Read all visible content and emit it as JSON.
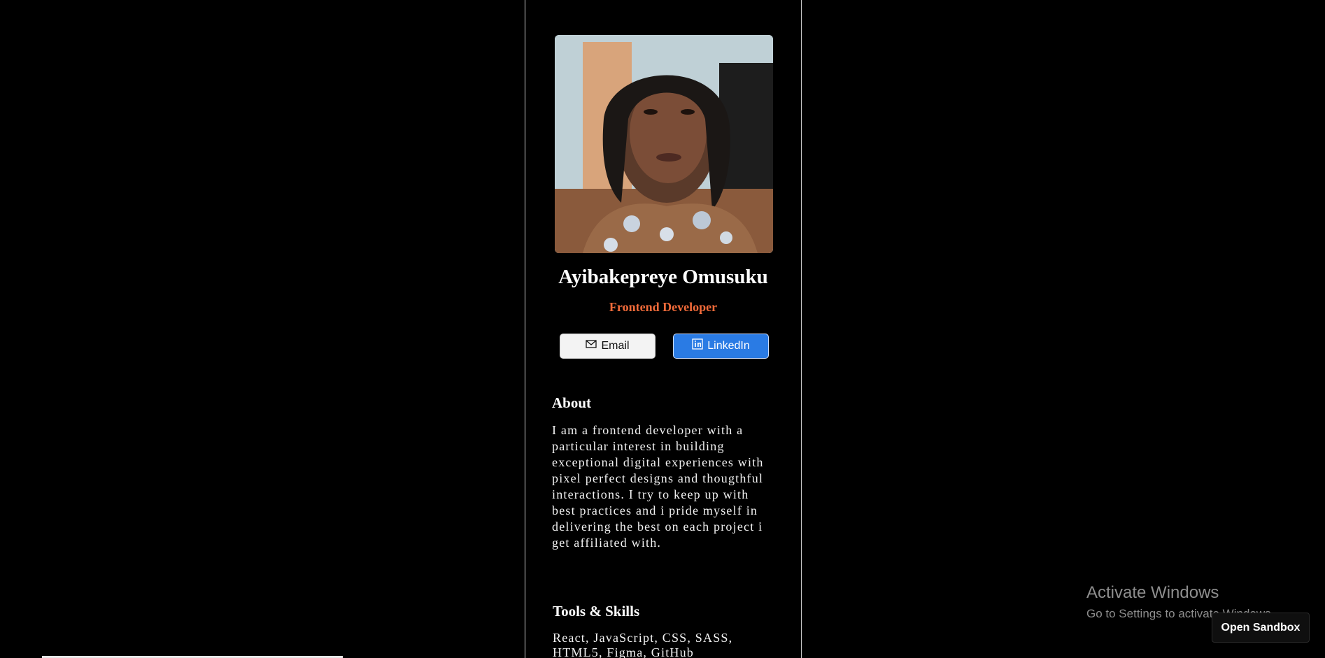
{
  "profile": {
    "name": "Ayibakepreye Omusuku",
    "role": "Frontend Developer"
  },
  "buttons": {
    "email_label": "Email",
    "linkedin_label": "LinkedIn",
    "email_icon": "mail-icon",
    "linkedin_icon": "linkedin-icon"
  },
  "about": {
    "title": "About",
    "text": "I am a frontend developer with a particular interest in building exceptional digital experiences with pixel perfect designs and thougthful interactions. I try to keep up with best practices and i pride myself in delivering the best on each project i get affiliated with."
  },
  "tools": {
    "title": "Tools & Skills",
    "text": "React, JavaScript, CSS, SASS, HTML5, Figma, GitHub"
  },
  "overlay": {
    "activate_title": "Activate Windows",
    "activate_subtitle": "Go to Settings to activate Windows.",
    "sandbox_label": "Open Sandbox"
  },
  "colors": {
    "background": "#000000",
    "role": "#f26b3a",
    "linkedin": "#2a7be4"
  }
}
